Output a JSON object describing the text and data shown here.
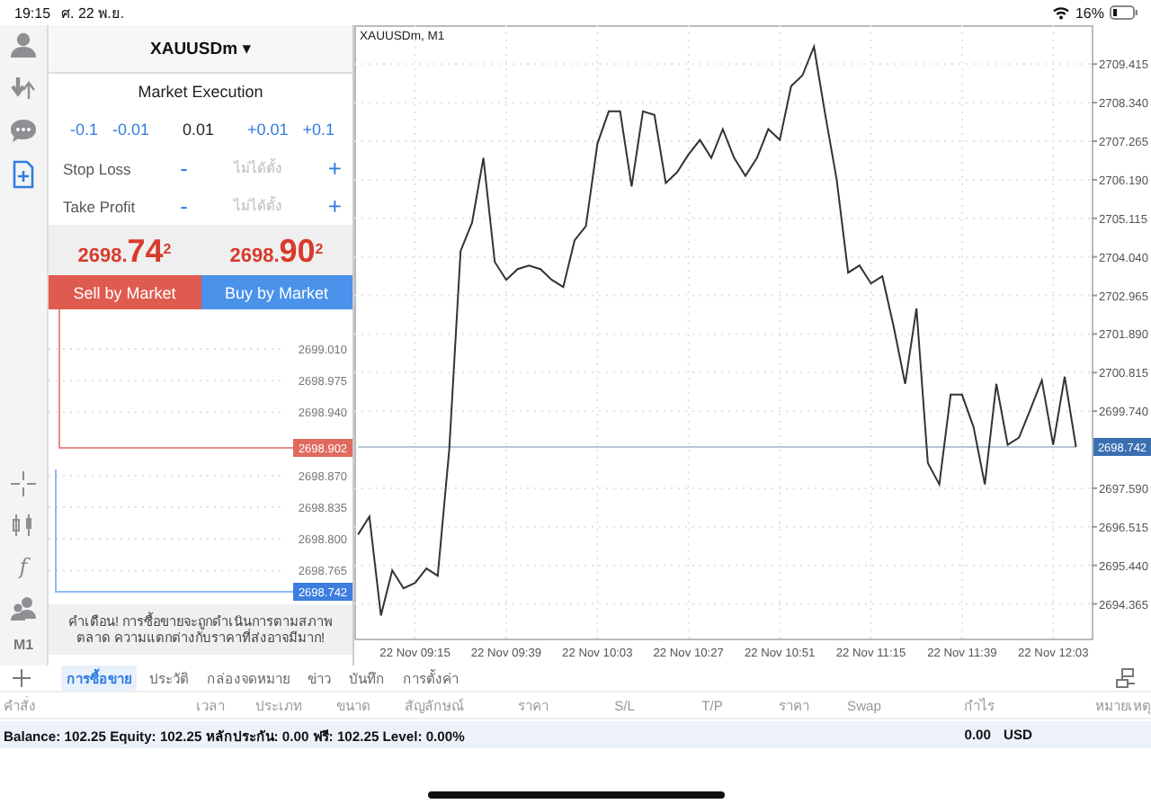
{
  "status_bar": {
    "time": "19:15",
    "date": "ศ. 22 พ.ย.",
    "battery": "16%"
  },
  "rail": {
    "tools": [
      {
        "kind": "account",
        "selected": false
      },
      {
        "kind": "trade",
        "selected": false
      },
      {
        "kind": "chat",
        "selected": false
      },
      {
        "kind": "new-order",
        "selected": true
      }
    ],
    "chart_tools": [
      {
        "kind": "crosshair"
      },
      {
        "kind": "chart-type"
      },
      {
        "kind": "indicators",
        "glyph": "f"
      },
      {
        "kind": "objects"
      }
    ],
    "timeframe": "M1"
  },
  "order": {
    "symbol": "XAUUSDm",
    "caret": "▾",
    "execution": "Market Execution",
    "volume": {
      "decrease": [
        "-0.1",
        "-0.01"
      ],
      "value": "0.01",
      "increase": [
        "+0.01",
        "+0.1"
      ]
    },
    "levels": [
      {
        "label": "Stop Loss",
        "minus": "-",
        "placeholder": "ไม่ได้ตั้ง",
        "plus": "+"
      },
      {
        "label": "Take Profit",
        "minus": "-",
        "placeholder": "ไม่ได้ตั้ง",
        "plus": "+"
      }
    ],
    "bid": {
      "main": "2698.",
      "big": "74",
      "sup": "2"
    },
    "ask": {
      "main": "2698.",
      "big": "90",
      "sup": "2"
    },
    "sell_button": "Sell by Market",
    "buy_button": "Buy by Market",
    "tick_chart": {
      "price_labels": [
        "2699.010",
        "2698.975",
        "2698.940",
        "2698.870",
        "2698.835",
        "2698.800",
        "2698.765"
      ],
      "ask_tag": "2698.902",
      "bid_tag": "2698.742"
    },
    "warning": "คำเตือน! การซื้อขายจะถูกดำเนินการตามสภาพตลาด ความแตกต่างกับราคาที่ส่งอาจมีมาก!"
  },
  "chart": {
    "title": "XAUUSDm, M1",
    "chart_data": {
      "type": "line",
      "categories": [
        null,
        null,
        null,
        null,
        null,
        "22 Nov 09:15",
        null,
        null,
        null,
        null,
        null,
        null,
        null,
        "22 Nov 09:39",
        null,
        null,
        null,
        null,
        null,
        null,
        null,
        "22 Nov 10:03",
        null,
        null,
        null,
        null,
        null,
        null,
        null,
        "22 Nov 10:27",
        null,
        null,
        null,
        null,
        null,
        null,
        null,
        "22 Nov 10:51",
        null,
        null,
        null,
        null,
        null,
        null,
        null,
        "22 Nov 11:15",
        null,
        null,
        null,
        null,
        null,
        null,
        null,
        "22 Nov 11:39",
        null,
        null,
        null,
        null,
        null,
        null,
        null,
        "22 Nov 12:03",
        null,
        null
      ],
      "ylim": [
        2693.4,
        2710.5
      ],
      "yticks": [
        {
          "value": 2709.415,
          "label": "2709.415"
        },
        {
          "value": 2708.34,
          "label": "2708.340"
        },
        {
          "value": 2707.265,
          "label": "2707.265"
        },
        {
          "value": 2706.19,
          "label": "2706.190"
        },
        {
          "value": 2705.115,
          "label": "2705.115"
        },
        {
          "value": 2704.04,
          "label": "2704.040"
        },
        {
          "value": 2702.965,
          "label": "2702.965"
        },
        {
          "value": 2701.89,
          "label": "2701.890"
        },
        {
          "value": 2700.815,
          "label": "2700.815"
        },
        {
          "value": 2699.74,
          "label": "2699.740"
        },
        {
          "value": 2697.59,
          "label": "2697.590"
        },
        {
          "value": 2696.515,
          "label": "2696.515"
        },
        {
          "value": 2695.44,
          "label": "2695.440"
        },
        {
          "value": 2694.365,
          "label": "2694.365"
        }
      ],
      "series": [
        {
          "color": "#333333",
          "values": [
            2696.3,
            2696.8,
            2694.04,
            2695.3,
            2694.8,
            2694.95,
            2695.35,
            2695.15,
            2698.67,
            2704.2,
            2705.0,
            2706.8,
            2703.9,
            2703.4,
            2703.7,
            2703.8,
            2703.7,
            2703.4,
            2703.2,
            2704.5,
            2704.9,
            2707.2,
            2708.1,
            2708.1,
            2706.0,
            2708.1,
            2708.0,
            2706.1,
            2706.4,
            2706.9,
            2707.3,
            2706.8,
            2707.6,
            2706.8,
            2706.3,
            2706.8,
            2707.6,
            2707.3,
            2708.8,
            2709.1,
            2709.9,
            2708.0,
            2706.2,
            2703.6,
            2703.8,
            2703.3,
            2703.5,
            2702.1,
            2700.5,
            2702.6,
            2698.3,
            2697.7,
            2700.2,
            2700.2,
            2699.3,
            2697.7,
            2700.5,
            2698.8,
            2699.0,
            2699.8,
            2700.6,
            2698.8,
            2700.7,
            2698.74
          ]
        },
        {
          "color": "#b8c4d4",
          "values": [
            2698.742,
            2698.742,
            2698.742,
            2698.742,
            2698.742,
            2698.742,
            2698.742,
            2698.742,
            2698.742,
            2698.742,
            2698.742,
            2698.742,
            2698.742,
            2698.742,
            2698.742,
            2698.742,
            2698.742,
            2698.742,
            2698.742,
            2698.742,
            2698.742,
            2698.742,
            2698.742,
            2698.742,
            2698.742,
            2698.742,
            2698.742,
            2698.742,
            2698.742,
            2698.742,
            2698.742,
            2698.742,
            2698.742,
            2698.742,
            2698.742,
            2698.742,
            2698.742,
            2698.742,
            2698.742,
            2698.742,
            2698.742,
            2698.742,
            2698.742,
            2698.742,
            2698.742,
            2698.742,
            2698.742,
            2698.742,
            2698.742,
            2698.742,
            2698.742,
            2698.742,
            2698.742,
            2698.742,
            2698.742,
            2698.742,
            2698.742,
            2698.742,
            2698.742,
            2698.742,
            2698.742,
            2698.742,
            2698.742,
            2698.742
          ]
        }
      ],
      "grid": true
    },
    "price_tag": "2698.742"
  },
  "terminal": {
    "tabs": [
      {
        "label": "การซื้อขาย",
        "selected": true
      },
      {
        "label": "ประวัติ",
        "selected": false
      },
      {
        "label": "กล่องจดหมาย",
        "selected": false
      },
      {
        "label": "ข่าว",
        "selected": false
      },
      {
        "label": "บันทึก",
        "selected": false
      },
      {
        "label": "การตั้งค่า",
        "selected": false
      }
    ],
    "columns": [
      "คำสั่ง",
      "เวลา",
      "ประเภท",
      "ขนาด",
      "สัญลักษณ์",
      "ราคา",
      "S/L",
      "T/P",
      "ราคา",
      "Swap",
      "กำไร",
      "หมายเหตุ"
    ],
    "summary": {
      "text": "Balance: 102.25 Equity: 102.25 หลักประกัน: 0.00 ฟรี: 102.25 Level: 0.00%",
      "profit": "0.00",
      "currency": "USD"
    }
  }
}
